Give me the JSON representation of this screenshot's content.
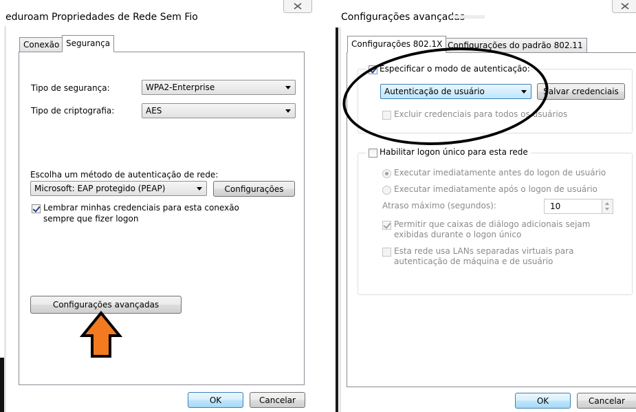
{
  "left_dialog": {
    "title": "eduroam Propriedades de Rede Sem Fio",
    "tabs": [
      {
        "label": "Conexão"
      },
      {
        "label": "Segurança"
      }
    ],
    "security_type_label": "Tipo de segurança:",
    "security_type_value": "WPA2-Enterprise",
    "encryption_type_label": "Tipo de criptografia:",
    "encryption_type_value": "AES",
    "auth_method_label": "Escolha um método de autenticação de rede:",
    "auth_method_value": "Microsoft: EAP protegido (PEAP)",
    "settings_button": "Configurações",
    "remember_line1": "Lembrar minhas credenciais para esta conexão",
    "remember_line2": "sempre que fizer logon",
    "advanced_button": "Configurações avançadas",
    "ok_button": "OK",
    "cancel_button": "Cancelar"
  },
  "right_dialog": {
    "title": "Configurações avançadas",
    "tabs": [
      {
        "label": "Configurações 802.1X"
      },
      {
        "label": "Configurações do padrão 802.11"
      }
    ],
    "specify_auth_label": "Especificar o modo de autenticação:",
    "auth_mode_value": "Autenticação de usuário",
    "save_credentials_button": "Salvar credenciais",
    "delete_credentials_label": "Excluir credenciais para todos os usuários",
    "sso_label": "Habilitar logon único para esta rede",
    "radio_before": "Executar imediatamente antes do logon de usuário",
    "radio_after": "Executar imediatamente após o logon de usuário",
    "max_delay_label": "Atraso máximo (segundos):",
    "max_delay_value": "10",
    "allow_dialogs_line1": "Permitir que caixas de diálogo adicionais sejam",
    "allow_dialogs_line2": "exibidas durante o logon único",
    "vlan_line1": "Esta rede usa LANs separadas virtuais para",
    "vlan_line2": "autenticação de máquina e de usuário",
    "ok_button": "OK",
    "cancel_button": "Cancelar"
  },
  "annotations": {
    "arrow_color": "#f47a20",
    "ellipse_color": "#000000"
  }
}
